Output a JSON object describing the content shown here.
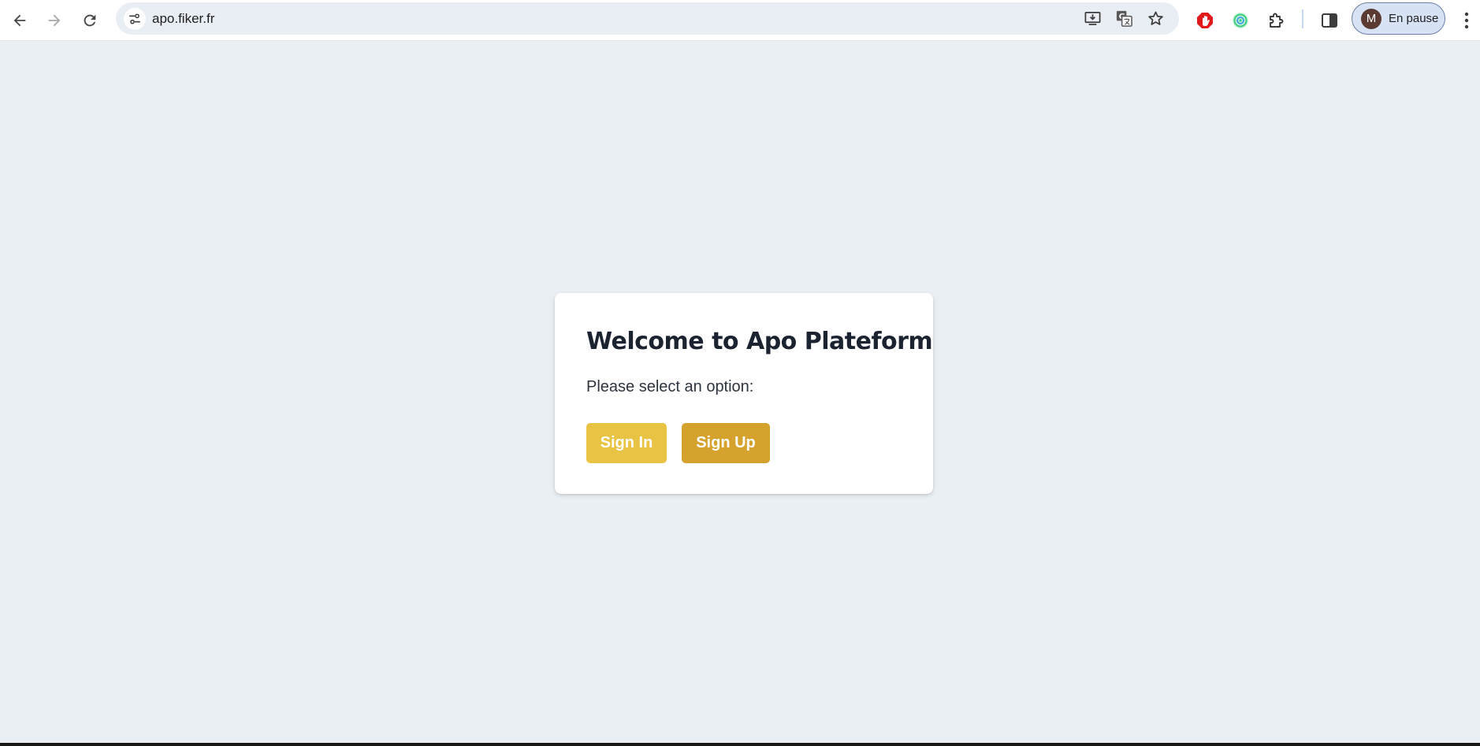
{
  "browser": {
    "url": "apo.fiker.fr",
    "profile": {
      "initial": "M",
      "label": "En pause"
    },
    "icons": {
      "back": "arrow-left-icon",
      "forward": "arrow-right-icon",
      "reload": "reload-icon",
      "site_info": "tune-icon",
      "install": "install-app-icon",
      "translate": "translate-icon",
      "bookmark": "star-icon",
      "extension_1": "adblock-hand-icon",
      "extension_2": "target-extension-icon",
      "extensions": "puzzle-icon",
      "side_panel": "side-panel-icon",
      "menu": "kebab-menu-icon"
    }
  },
  "page": {
    "card": {
      "title": "Welcome to Apo Plateform",
      "subtitle": "Please select an option:",
      "sign_in_label": "Sign In",
      "sign_up_label": "Sign Up"
    }
  },
  "colors": {
    "background": "#eaeff4",
    "sign_in": "#e9c343",
    "sign_up": "#d6a22e",
    "title": "#1b2230"
  }
}
